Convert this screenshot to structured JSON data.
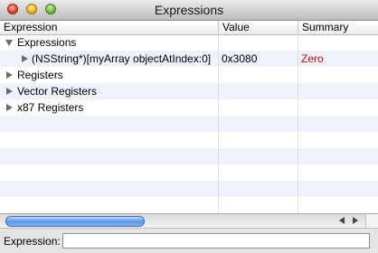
{
  "window": {
    "title": "Expressions"
  },
  "columns": {
    "expression": "Expression",
    "value": "Value",
    "summary": "Summary"
  },
  "rows": [
    {
      "expression": "Expressions",
      "value": "",
      "summary": "",
      "expanded": true,
      "level": 0
    },
    {
      "expression": "(NSString*)[myArray objectAtIndex:0]",
      "value": "0x3080",
      "summary": "Zero",
      "expanded": false,
      "level": 1
    },
    {
      "expression": "Registers",
      "value": "",
      "summary": "",
      "expanded": false,
      "level": 0
    },
    {
      "expression": "Vector Registers",
      "value": "",
      "summary": "",
      "expanded": false,
      "level": 0
    },
    {
      "expression": "x87 Registers",
      "value": "",
      "summary": "",
      "expanded": false,
      "level": 0
    }
  ],
  "bottom_bar": {
    "label": "Expression:",
    "input_value": ""
  },
  "colors": {
    "summary_text": "#d40000",
    "alt_row": "#eef3fb"
  }
}
